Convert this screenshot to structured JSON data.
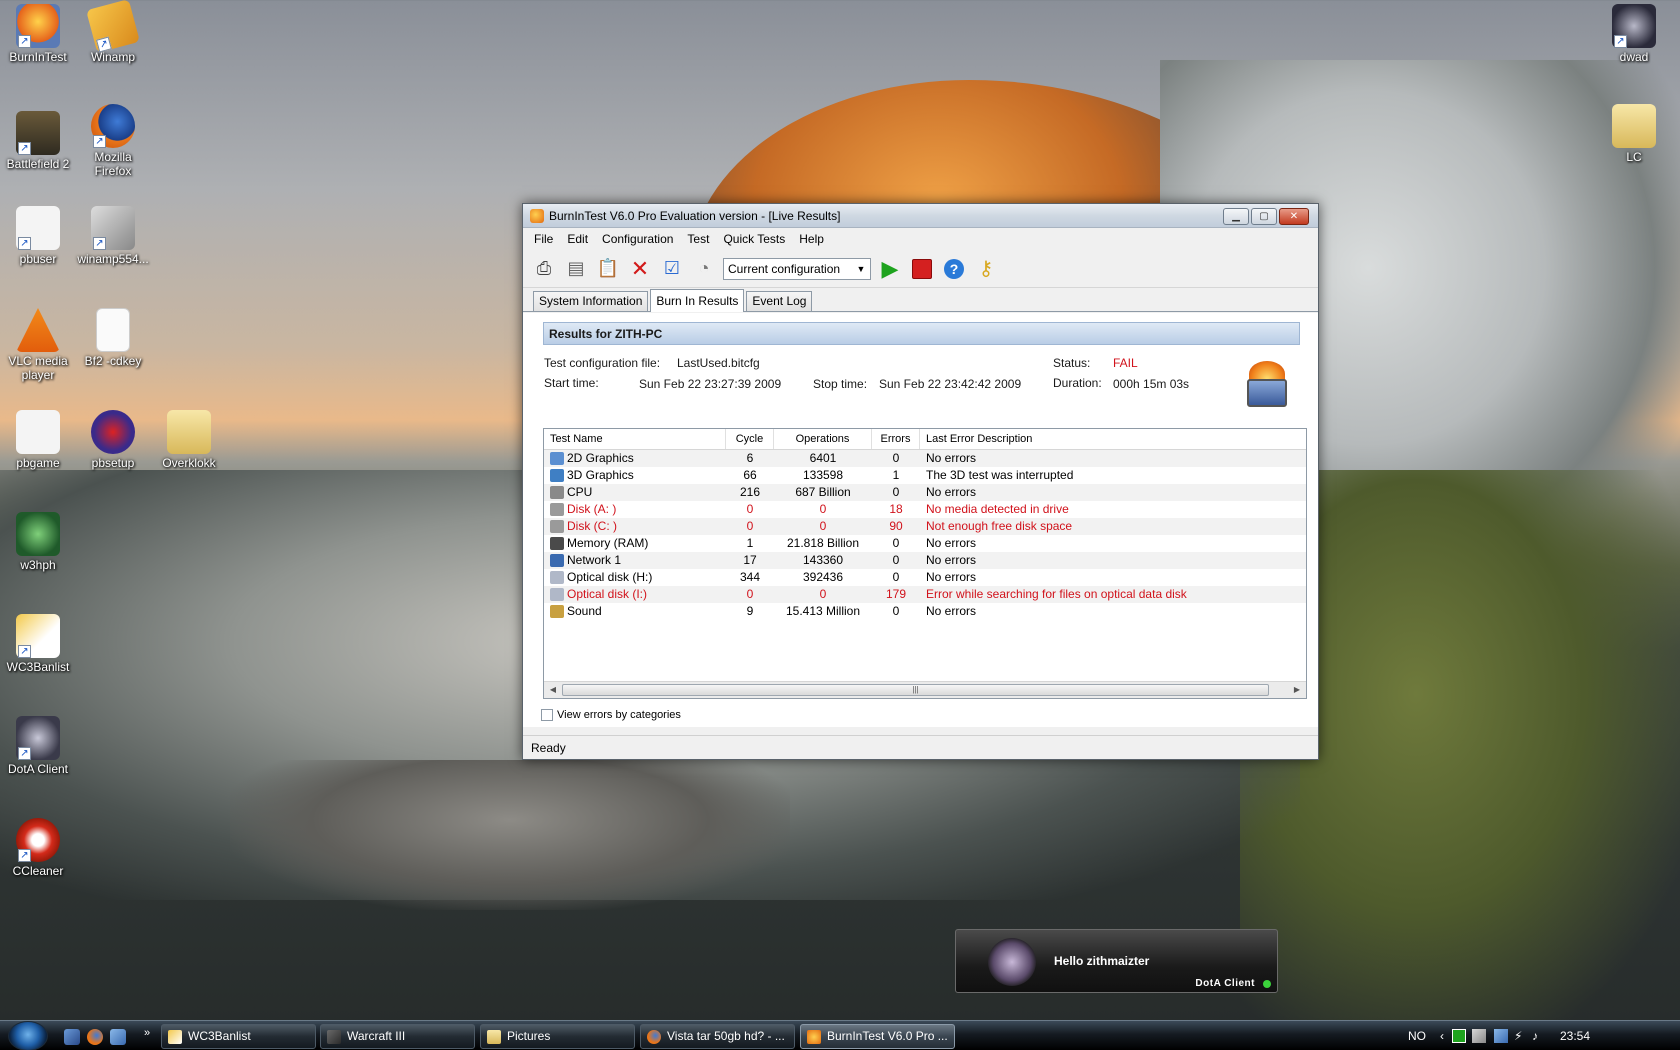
{
  "desktop": {
    "icons": [
      {
        "label": "BurnInTest",
        "x": 0
      },
      {
        "label": "Winamp"
      },
      {
        "label": "Battlefield 2"
      },
      {
        "label": "Mozilla Firefox"
      },
      {
        "label": "pbuser"
      },
      {
        "label": "winamp554..."
      },
      {
        "label": "VLC media player"
      },
      {
        "label": "Bf2 -cdkey"
      },
      {
        "label": "pbgame"
      },
      {
        "label": "pbsetup"
      },
      {
        "label": "Overklokk"
      },
      {
        "label": "w3hph"
      },
      {
        "label": "WC3Banlist"
      },
      {
        "label": "DotA Client"
      },
      {
        "label": "CCleaner"
      },
      {
        "label": "dwad"
      },
      {
        "label": "LC"
      }
    ]
  },
  "window": {
    "title": "BurnInTest V6.0 Pro Evaluation version - [Live Results]",
    "menu": [
      "File",
      "Edit",
      "Configuration",
      "Test",
      "Quick Tests",
      "Help"
    ],
    "config_select": "Current configuration",
    "tabs": [
      "System Information",
      "Burn In Results",
      "Event Log"
    ],
    "results_header": "Results for ZITH-PC",
    "config_file_label": "Test configuration file:",
    "config_file": "LastUsed.bitcfg",
    "status_label": "Status:",
    "status": "FAIL",
    "start_label": "Start time:",
    "start_time": "Sun Feb 22 23:27:39 2009",
    "stop_label": "Stop time:",
    "stop_time": "Sun Feb 22 23:42:42 2009",
    "duration_label": "Duration:",
    "duration": "000h 15m 03s",
    "columns": [
      "Test Name",
      "Cycle",
      "Operations",
      "Errors",
      "Last Error Description"
    ],
    "rows": [
      {
        "name": "2D Graphics",
        "cycle": "6",
        "ops": "6401",
        "errors": "0",
        "desc": "No errors",
        "error": false,
        "icon_color": "#5b8fd1"
      },
      {
        "name": "3D Graphics",
        "cycle": "66",
        "ops": "133598",
        "errors": "1",
        "desc": "The 3D test was interrupted",
        "error": false,
        "icon_color": "#3f7fc4"
      },
      {
        "name": "CPU",
        "cycle": "216",
        "ops": "687 Billion",
        "errors": "0",
        "desc": "No errors",
        "error": false,
        "icon_color": "#8a8a8a"
      },
      {
        "name": "Disk (A: )",
        "cycle": "0",
        "ops": "0",
        "errors": "18",
        "desc": "No media detected in drive",
        "error": true,
        "icon_color": "#9a9a9a"
      },
      {
        "name": "Disk (C: )",
        "cycle": "0",
        "ops": "0",
        "errors": "90",
        "desc": "Not enough free disk space",
        "error": true,
        "icon_color": "#9a9a9a"
      },
      {
        "name": "Memory (RAM)",
        "cycle": "1",
        "ops": "21.818 Billion",
        "errors": "0",
        "desc": "No errors",
        "error": false,
        "icon_color": "#4a4a4a"
      },
      {
        "name": "Network 1",
        "cycle": "17",
        "ops": "143360",
        "errors": "0",
        "desc": "No errors",
        "error": false,
        "icon_color": "#3a6ab0"
      },
      {
        "name": "Optical disk (H:)",
        "cycle": "344",
        "ops": "392436",
        "errors": "0",
        "desc": "No errors",
        "error": false,
        "icon_color": "#b0b8c8"
      },
      {
        "name": "Optical disk (I:)",
        "cycle": "0",
        "ops": "0",
        "errors": "179",
        "desc": "Error while searching for files on optical data disk",
        "error": true,
        "icon_color": "#b0b8c8"
      },
      {
        "name": "Sound",
        "cycle": "9",
        "ops": "15.413 Million",
        "errors": "0",
        "desc": "No errors",
        "error": false,
        "icon_color": "#c8a040"
      }
    ],
    "checkbox_label": "View errors by categories",
    "status_bar": "Ready"
  },
  "notification": {
    "message": "Hello zithmaizter",
    "source": "DotA Client"
  },
  "taskbar": {
    "tasks": [
      "WC3Banlist",
      "Warcraft III",
      "Pictures",
      "Vista tar 50gb hd? - ...",
      "BurnInTest V6.0 Pro ..."
    ],
    "language": "NO",
    "clock": "23:54"
  }
}
